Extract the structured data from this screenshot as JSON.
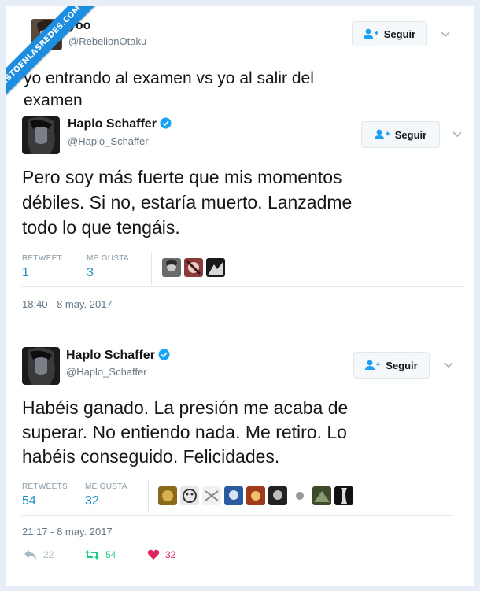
{
  "watermark": "VISTOENLASREDES.COM",
  "post": {
    "author_name": "yoo",
    "author_handle": "@RebelionOtaku",
    "follow_label": "Seguir",
    "text_line1": "yo entrando al examen vs yo al salir del",
    "text_line2": "examen"
  },
  "tweet1": {
    "author_name": "Haplo Schaffer",
    "author_handle": "@Haplo_Schaffer",
    "follow_label": "Seguir",
    "text_line1": "Pero soy más fuerte que mis momentos",
    "text_line2": "débiles. Si no, estaría muerto. Lanzadme",
    "text_line3": "todo lo que tengáis.",
    "retweet_label": "RETWEET",
    "retweet_count": "1",
    "likes_label": "ME GUSTA",
    "likes_count": "3",
    "timestamp": "18:40 - 8 may. 2017"
  },
  "tweet2": {
    "author_name": "Haplo Schaffer",
    "author_handle": "@Haplo_Schaffer",
    "follow_label": "Seguir",
    "text_line1": "Habéis ganado. La presión me acaba de",
    "text_line2": "superar. No entiendo nada. Me retiro. Lo",
    "text_line3": "habéis conseguido. Felicidades.",
    "retweet_label": "RETWEETS",
    "retweet_count": "54",
    "likes_label": "ME GUSTA",
    "likes_count": "32",
    "timestamp": "21:17 - 8 may. 2017",
    "reply_count": "22",
    "rt_action_count": "54",
    "like_action_count": "32"
  },
  "colors": {
    "link_blue": "#1d8dc7",
    "retweet_green": "#19cf86",
    "like_red": "#e0245e",
    "watermark_blue": "#1d8de0"
  }
}
